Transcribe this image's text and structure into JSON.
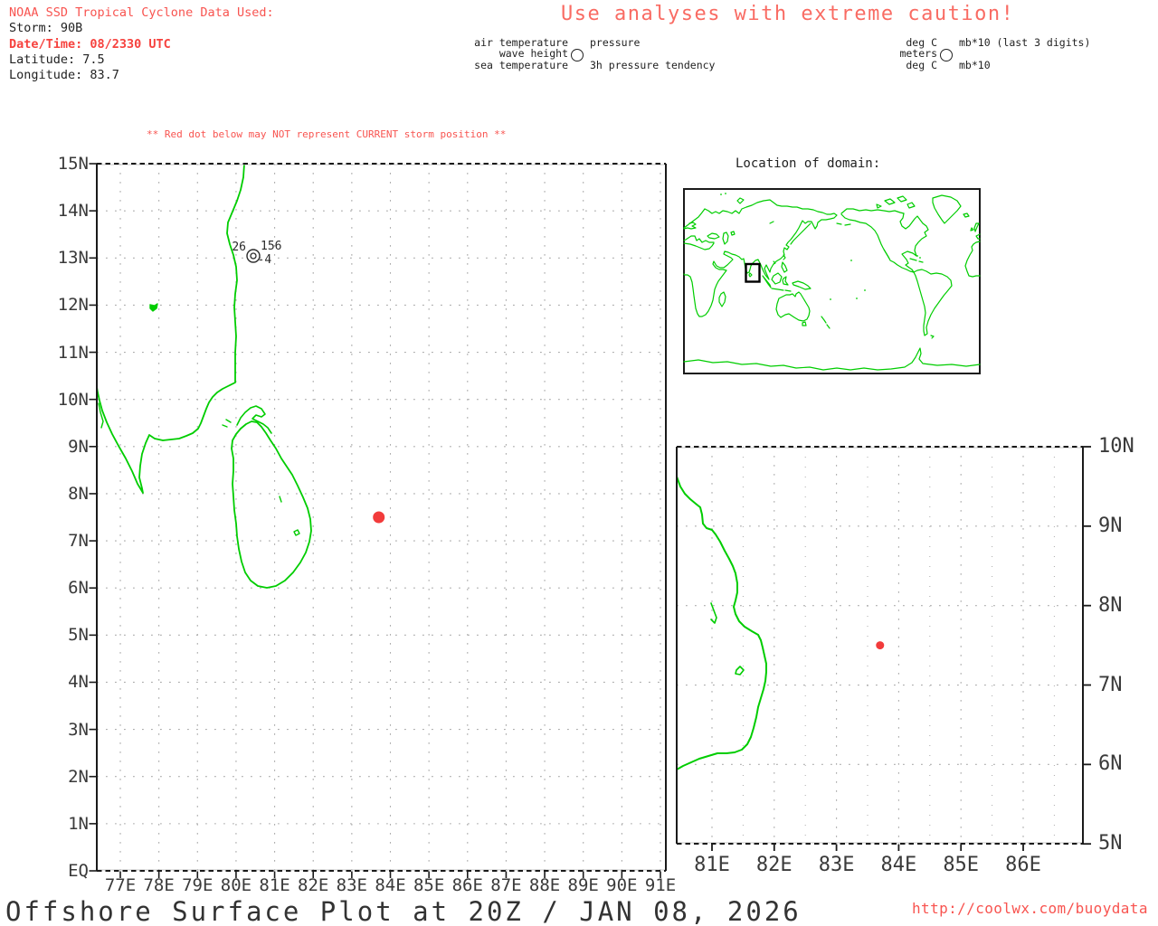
{
  "header": {
    "info": [
      {
        "text": "NOAA SSD Tropical Cyclone Data Used:",
        "style": "red"
      },
      {
        "text": "Storm: 90B",
        "style": "black"
      },
      {
        "text": "Date/Time: 08/2330 UTC",
        "style": "red-bold"
      },
      {
        "text": "Latitude: 7.5",
        "style": "black"
      },
      {
        "text": "Longitude: 83.7",
        "style": "black"
      }
    ],
    "caution_text": "Use analyses with extreme caution!",
    "station_legend": {
      "left_lines": [
        "air temperature",
        "wave height",
        "sea temperature"
      ],
      "right_top": "pressure",
      "right_bottom": "3h pressure tendency"
    },
    "units_legend": {
      "left_lines": [
        "deg C",
        "meters",
        "deg C"
      ],
      "right_top": "mb*10 (last 3 digits)",
      "right_bottom": "mb*10"
    }
  },
  "main_map": {
    "warning_text": "** Red dot below may NOT represent CURRENT storm position **",
    "x_labels": [
      "77E",
      "78E",
      "79E",
      "80E",
      "81E",
      "82E",
      "83E",
      "84E",
      "85E",
      "86E",
      "87E",
      "88E",
      "89E",
      "90E",
      "91E"
    ],
    "y_labels": [
      "15N",
      "14N",
      "13N",
      "12N",
      "11N",
      "10N",
      "9N",
      "8N",
      "7N",
      "6N",
      "5N",
      "4N",
      "3N",
      "2N",
      "1N",
      "EQ"
    ],
    "station_plot": {
      "air_temperature": "26",
      "pressure": "156",
      "pressure_tendency": "-4"
    },
    "storm_dot": {
      "lat": 7.5,
      "lon": 83.7
    }
  },
  "domain_inset": {
    "title": "Location of domain:"
  },
  "zoom_inset": {
    "x_labels": [
      "81E",
      "82E",
      "83E",
      "84E",
      "85E",
      "86E"
    ],
    "y_labels": [
      "10N",
      "9N",
      "8N",
      "7N",
      "6N",
      "5N"
    ],
    "storm_dot": {
      "lat": 7.5,
      "lon": 83.7
    }
  },
  "footer": {
    "title": "Offshore Surface Plot at 20Z / JAN 08, 2026",
    "url": "http://coolwx.com/buoydata"
  },
  "colors": {
    "red_text": "#f85450",
    "red_bold": "#f6423e",
    "caution_red": "#f96b63",
    "coast_green": "#00cd00",
    "storm_red": "#f23b3b",
    "grid_gray": "#ababab",
    "axis_text": "#3a3a3a",
    "ink": "#1a1a1a"
  }
}
